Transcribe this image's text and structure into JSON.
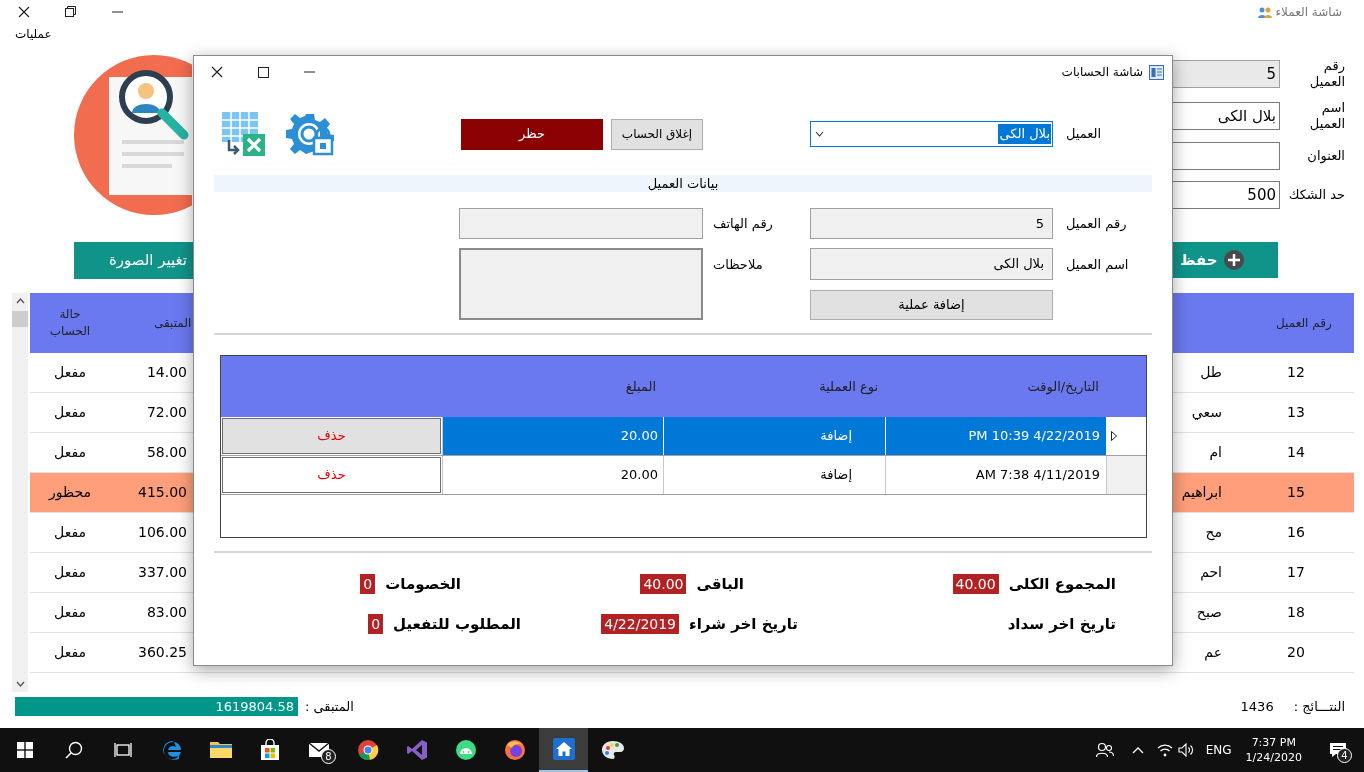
{
  "app_window": {
    "title": "شاشة العملاء",
    "menu": [
      "عمليات"
    ]
  },
  "customer_form": {
    "fields": [
      {
        "label": "رقم العميل",
        "value": "5",
        "kind": "readonly"
      },
      {
        "label": "اسم العميل",
        "value": "بلال الكى",
        "kind": "input"
      },
      {
        "label": "العنوان",
        "kind": "input"
      },
      {
        "label": "حد الشكك",
        "value": "500",
        "kind": "input"
      }
    ],
    "change_photo_button": "تغيير الصورة",
    "save_button": "حفظ"
  },
  "customers_table": {
    "columns": [
      "رقم العميل",
      "المتبقى",
      "حالة الحساب"
    ],
    "rows": [
      {
        "number": "12",
        "name": "طل",
        "remaining": "14.00",
        "status": "مفعل",
        "blocked": false
      },
      {
        "number": "13",
        "name": "سعي",
        "remaining": "72.00",
        "status": "مفعل",
        "blocked": false
      },
      {
        "number": "14",
        "name": "ام",
        "remaining": "58.00",
        "status": "مفعل",
        "blocked": false
      },
      {
        "number": "15",
        "name": "ابراهيم",
        "remaining": "415.00",
        "status": "محظور",
        "blocked": true
      },
      {
        "number": "16",
        "name": "مح",
        "remaining": "106.00",
        "status": "مفعل",
        "blocked": false
      },
      {
        "number": "17",
        "name": "احم",
        "remaining": "337.00",
        "status": "مفعل",
        "blocked": false
      },
      {
        "number": "18",
        "name": "صبح",
        "remaining": "83.00",
        "status": "مفعل",
        "blocked": false
      },
      {
        "number": "20",
        "name": "عم",
        "remaining": "360.25",
        "status": "مفعل",
        "blocked": false
      }
    ]
  },
  "footer": {
    "remaining_label": "المتبقى :",
    "remaining_value": "1619804.58",
    "results_label": "النتـــائج :",
    "results_value": "1436"
  },
  "dialog": {
    "title": "شاشة الحسابات",
    "customer_label": "العميل",
    "customer_select": "بلال الكى",
    "close_account_button": "إغلاق الحساب",
    "block_button": "حظر",
    "section_title": "بيانات العميل",
    "customer_number_label": "رقم العميل",
    "customer_number": "5",
    "phone_label": "رقم الهاتف",
    "customer_name_label": "اسم العميل",
    "customer_name": "بلال الكى",
    "notes_label": "ملاحظات",
    "add_operation_button": "إضافة عملية",
    "operations": {
      "columns": [
        "التاريخ/الوقت",
        "نوع العملية",
        "المبلغ"
      ],
      "rows": [
        {
          "datetime": "4/22/2019 10:39 PM",
          "type": "إضافة",
          "amount": "20.00",
          "delete": "حذف",
          "selected": true
        },
        {
          "datetime": "4/11/2019 7:38 AM",
          "type": "إضافة",
          "amount": "20.00",
          "delete": "حذف",
          "selected": false
        }
      ]
    },
    "summary": [
      [
        {
          "label": "المجموع الكلى",
          "value": "40.00"
        },
        {
          "label": "الباقى",
          "value": "40.00"
        },
        {
          "label": "الخصومات",
          "value": "0"
        }
      ],
      [
        {
          "label": "تاريخ اخر سداد"
        },
        {
          "label": "تاريخ اخر شراء",
          "value": "4/22/2019"
        },
        {
          "label": "المطلوب للتفعيل",
          "value": "0"
        }
      ]
    ]
  },
  "taskbar": {
    "items": [
      {
        "kind": "start",
        "selected": false
      },
      {
        "kind": "search",
        "selected": false
      },
      {
        "kind": "taskview",
        "selected": false
      },
      {
        "kind": "edge",
        "selected": false
      },
      {
        "kind": "folder",
        "selected": false
      },
      {
        "kind": "store",
        "selected": false
      },
      {
        "kind": "mail",
        "badge": "8",
        "selected": false
      },
      {
        "kind": "chrome",
        "selected": false
      },
      {
        "kind": "vs",
        "selected": false
      },
      {
        "kind": "android",
        "selected": false
      },
      {
        "kind": "firefox",
        "selected": false
      },
      {
        "kind": "home",
        "selected": true
      },
      {
        "kind": "paint",
        "selected": false
      }
    ],
    "language": "ENG",
    "time": "7:37 PM",
    "date": "1/24/2020",
    "notifications": "4"
  }
}
